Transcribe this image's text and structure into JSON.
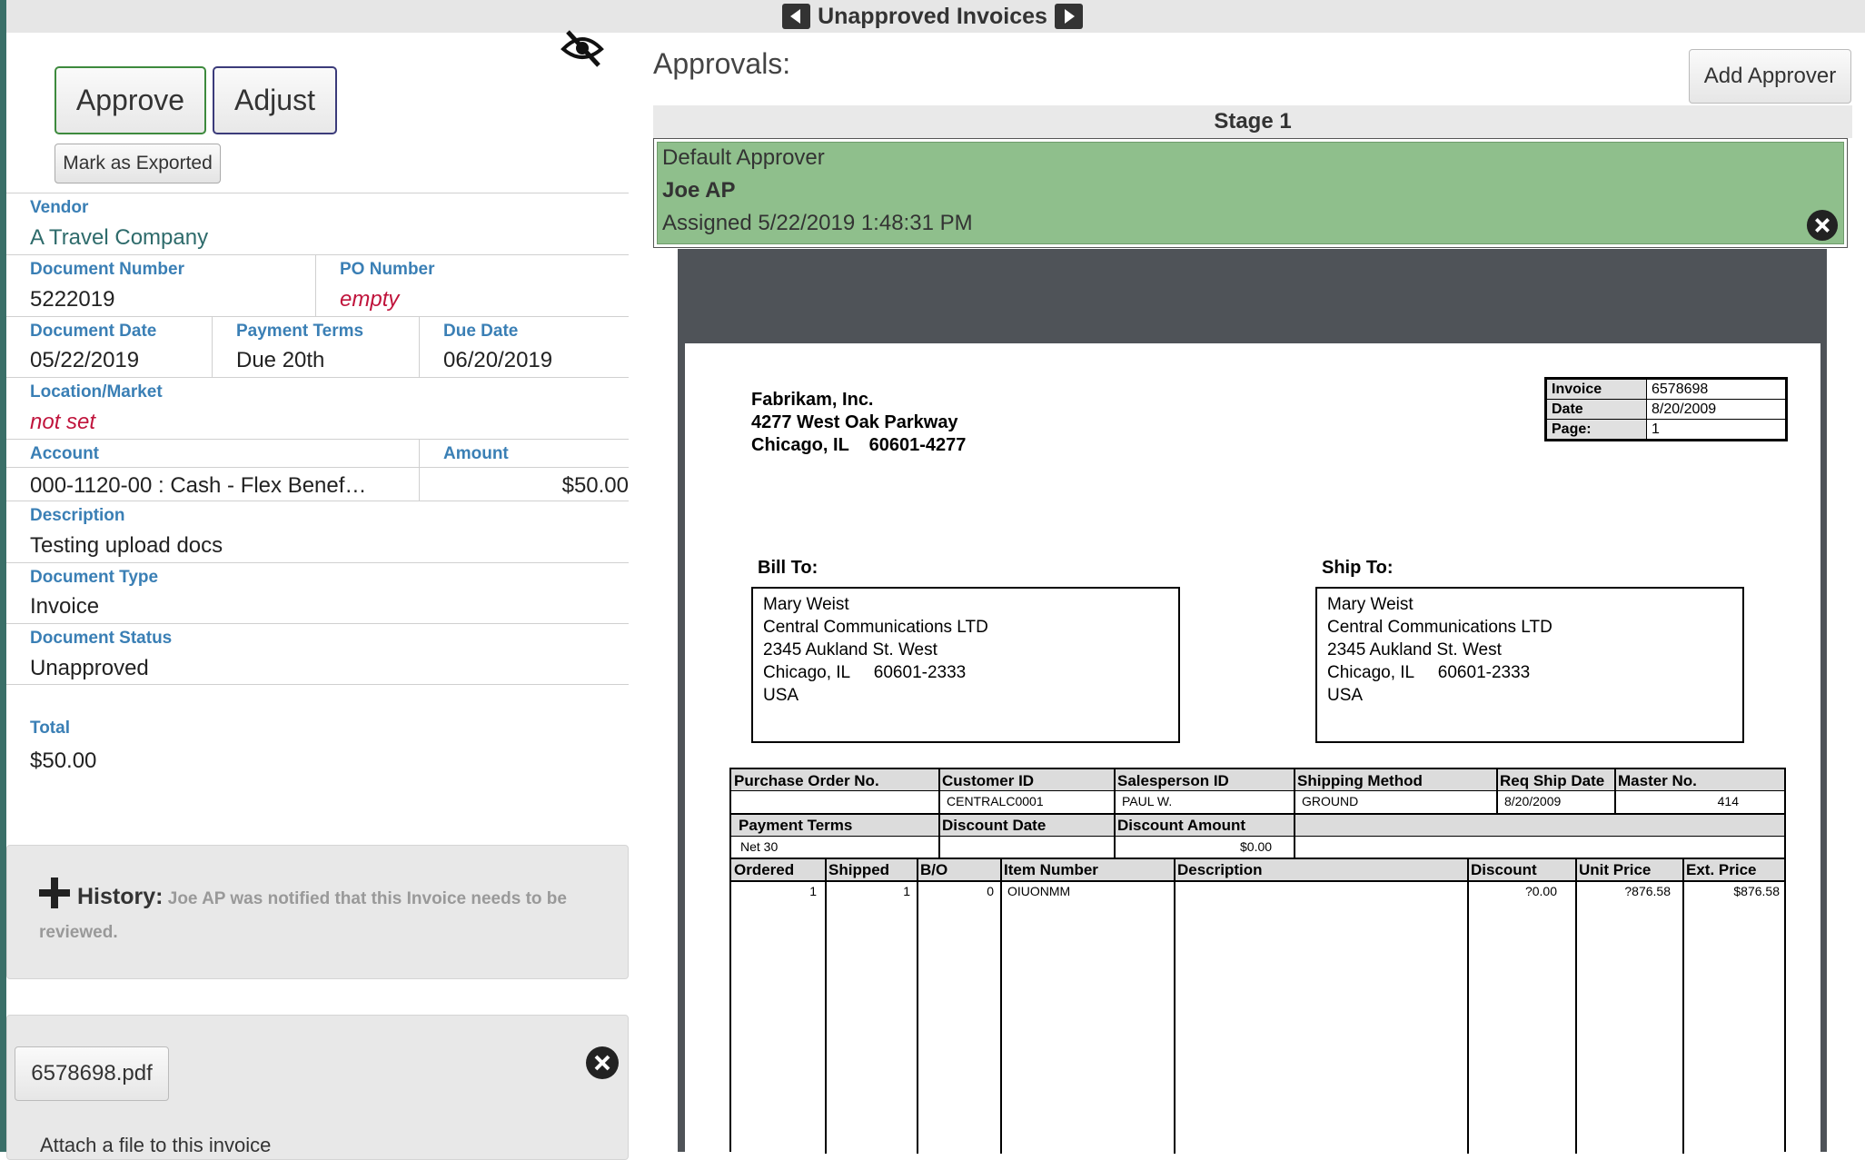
{
  "nav": {
    "title": "Unapproved Invoices"
  },
  "actions": {
    "approve": "Approve",
    "adjust": "Adjust",
    "mark_exported": "Mark as Exported"
  },
  "fields": {
    "vendor_label": "Vendor",
    "vendor": "A Travel Company",
    "doc_number_label": "Document Number",
    "doc_number": "5222019",
    "po_label": "PO Number",
    "po": "empty",
    "doc_date_label": "Document Date",
    "doc_date": "05/22/2019",
    "terms_label": "Payment Terms",
    "terms": "Due 20th",
    "due_label": "Due Date",
    "due": "06/20/2019",
    "location_label": "Location/Market",
    "location": "not set",
    "account_label": "Account",
    "account": "000-1120-00 : Cash - Flex Benef…",
    "amount_label": "Amount",
    "amount": "$50.00",
    "description_label": "Description",
    "description": "Testing upload docs",
    "doctype_label": "Document Type",
    "doctype": "Invoice",
    "status_label": "Document Status",
    "status": "Unapproved",
    "total_label": "Total",
    "total": "$50.00"
  },
  "history": {
    "label": "History:",
    "text": "Joe AP was notified that this Invoice needs to be reviewed."
  },
  "attachment": {
    "file": "6578698.pdf",
    "attach_link": "Attach a file to this invoice"
  },
  "approvals": {
    "title": "Approvals:",
    "add_button": "Add Approver",
    "stage": "Stage 1",
    "approver_role": "Default Approver",
    "approver_name": "Joe AP",
    "assigned": "Assigned 5/22/2019 1:48:31 PM",
    "approver_bg": "#8fbf8c"
  },
  "invoice": {
    "company": [
      "Fabrikam, Inc.",
      "4277 West Oak Parkway",
      "Chicago, IL    60601-4277"
    ],
    "meta": [
      {
        "k": "Invoice",
        "v": "6578698"
      },
      {
        "k": "Date",
        "v": "8/20/2009"
      },
      {
        "k": "Page:",
        "v": "1"
      }
    ],
    "bill_to_label": "Bill To:",
    "ship_to_label": "Ship To:",
    "bill_to": [
      "Mary Weist",
      "Central Communications LTD",
      "2345 Aukland St. West",
      "Chicago, IL     60601-2333",
      "USA"
    ],
    "ship_to": [
      "Mary Weist",
      "Central Communications LTD",
      "2345 Aukland St. West",
      "Chicago, IL     60601-2333",
      "USA"
    ],
    "h1": {
      "po": "Purchase Order No.",
      "cust": "Customer ID",
      "sales": "Salesperson ID",
      "ship": "Shipping Method",
      "req": "Req Ship Date",
      "master": "Master No."
    },
    "r1": {
      "po": "",
      "cust": "CENTRALC0001",
      "sales": "PAUL W.",
      "ship": "GROUND",
      "req": "8/20/2009",
      "master": "414"
    },
    "h2": {
      "terms": "Payment Terms",
      "disc_date": "Discount Date",
      "disc_amt": "Discount Amount"
    },
    "r2": {
      "terms": "Net 30",
      "disc_date": "",
      "disc_amt": "$0.00"
    },
    "h3": {
      "ordered": "Ordered",
      "shipped": "Shipped",
      "bo": "B/O",
      "item": "Item Number",
      "desc": "Description",
      "discount": "Discount",
      "unit": "Unit Price",
      "ext": "Ext. Price"
    },
    "line": {
      "ordered": "1",
      "shipped": "1",
      "bo": "0",
      "item": "OIUONMM",
      "desc": "",
      "discount": "?0.00",
      "unit": "?876.58",
      "ext": "$876.58"
    }
  }
}
